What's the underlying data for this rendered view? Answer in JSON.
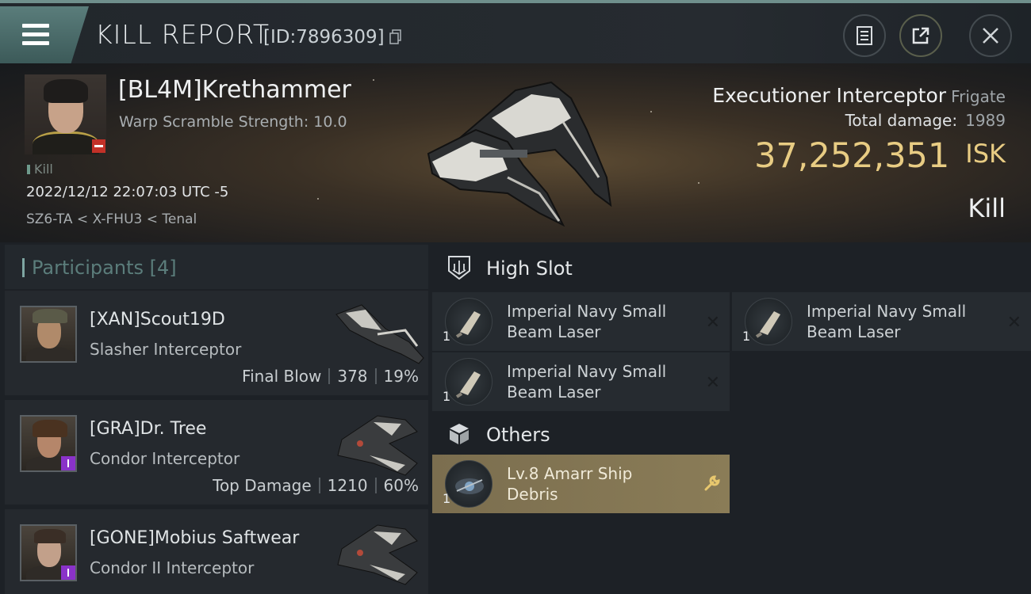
{
  "header": {
    "title": "KILL REPORT",
    "report_id": "[ID:7896309]"
  },
  "victim": {
    "pilot_name": "[BL4M]Krethammer",
    "warp_scramble": "Warp Scramble Strength: 10.0",
    "kill_tag": "Kill",
    "datetime": "2022/12/12 22:07:03 UTC -5",
    "location": "SZ6-TA < X-FHU3 < Tenal",
    "ship_name": "Executioner Interceptor",
    "ship_class": "Frigate",
    "total_damage_label": "Total damage:",
    "total_damage": "1989",
    "isk_value": "37,252,351",
    "isk_unit": "ISK",
    "result": "Kill"
  },
  "participants": {
    "label": "Participants",
    "count": "[4]",
    "rows": [
      {
        "name": "[XAN]Scout19D",
        "ship": "Slasher Interceptor",
        "tag": "Final Blow",
        "damage": "378",
        "percent": "19%"
      },
      {
        "name": "[GRA]Dr. Tree",
        "ship": "Condor Interceptor",
        "tag": "Top Damage",
        "damage": "1210",
        "percent": "60%"
      },
      {
        "name": "[GONE]Mobius Saftwear",
        "ship": "Condor II Interceptor"
      }
    ]
  },
  "high_slot": {
    "label": "High Slot",
    "items": [
      {
        "line1": "Imperial Navy Small",
        "line2": "Beam Laser",
        "qty": "1"
      },
      {
        "line1": "Imperial Navy Small",
        "line2": "Beam Laser",
        "qty": "1"
      },
      {
        "line1": "Imperial Navy Small",
        "line2": "Beam Laser",
        "qty": "1"
      }
    ]
  },
  "others": {
    "label": "Others",
    "items": [
      {
        "line1": "Lv.8 Amarr Ship",
        "line2": "Debris",
        "qty": "1"
      }
    ]
  },
  "colors": {
    "accent": "#5b7d7b",
    "isk": "#e8cc83",
    "selected": "#8a7c57",
    "badge_red": "#c23128",
    "corp_purple": "#8a32c9"
  }
}
